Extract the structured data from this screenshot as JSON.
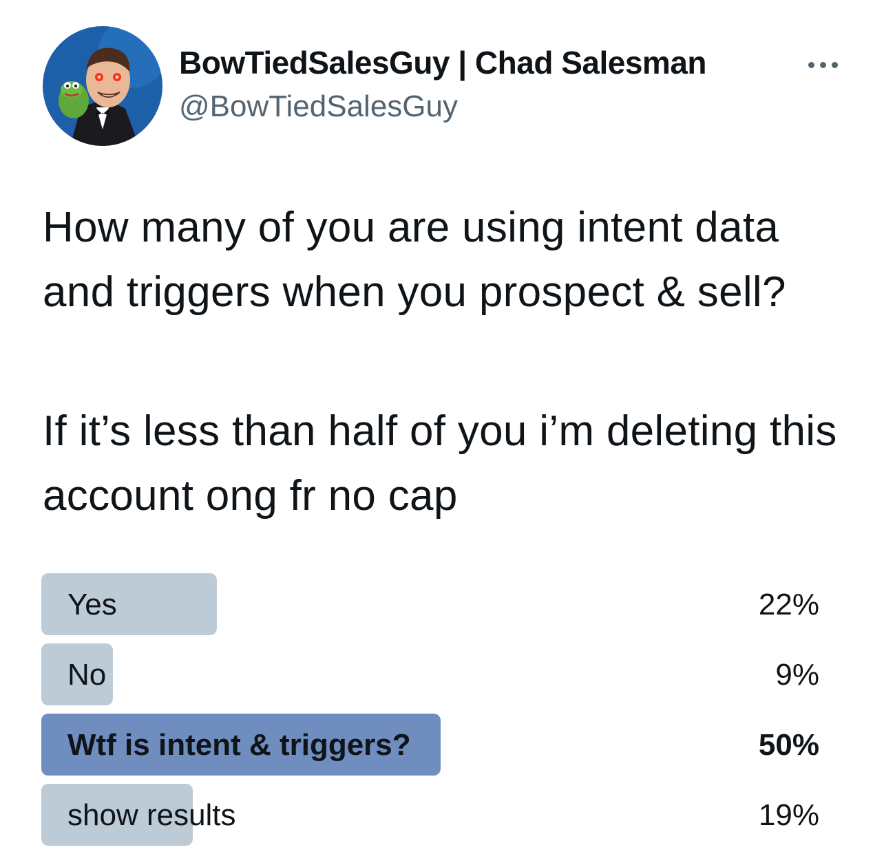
{
  "author": {
    "display_name": "BowTiedSalesGuy | Chad Salesman",
    "handle": "@BowTiedSalesGuy",
    "avatar_icon": "profile-avatar"
  },
  "more_icon": "more-options-icon",
  "tweet": {
    "paragraph_1": "How many of you are using intent data and triggers when you prospect & sell?",
    "paragraph_2": "If it’s less than half of you i’m deleting this account ong fr no cap"
  },
  "poll": {
    "options": [
      {
        "label": "Yes",
        "percent": "22%",
        "value": 22,
        "leading": false
      },
      {
        "label": "No",
        "percent": "9%",
        "value": 9,
        "leading": false
      },
      {
        "label": "Wtf is intent & triggers?",
        "percent": "50%",
        "value": 50,
        "leading": true
      },
      {
        "label": "show results",
        "percent": "19%",
        "value": 19,
        "leading": false
      }
    ]
  },
  "colors": {
    "bar": "#bccbd5",
    "bar_leading": "#6f8dbf",
    "text_primary": "#0f1419",
    "text_secondary": "#536471"
  }
}
